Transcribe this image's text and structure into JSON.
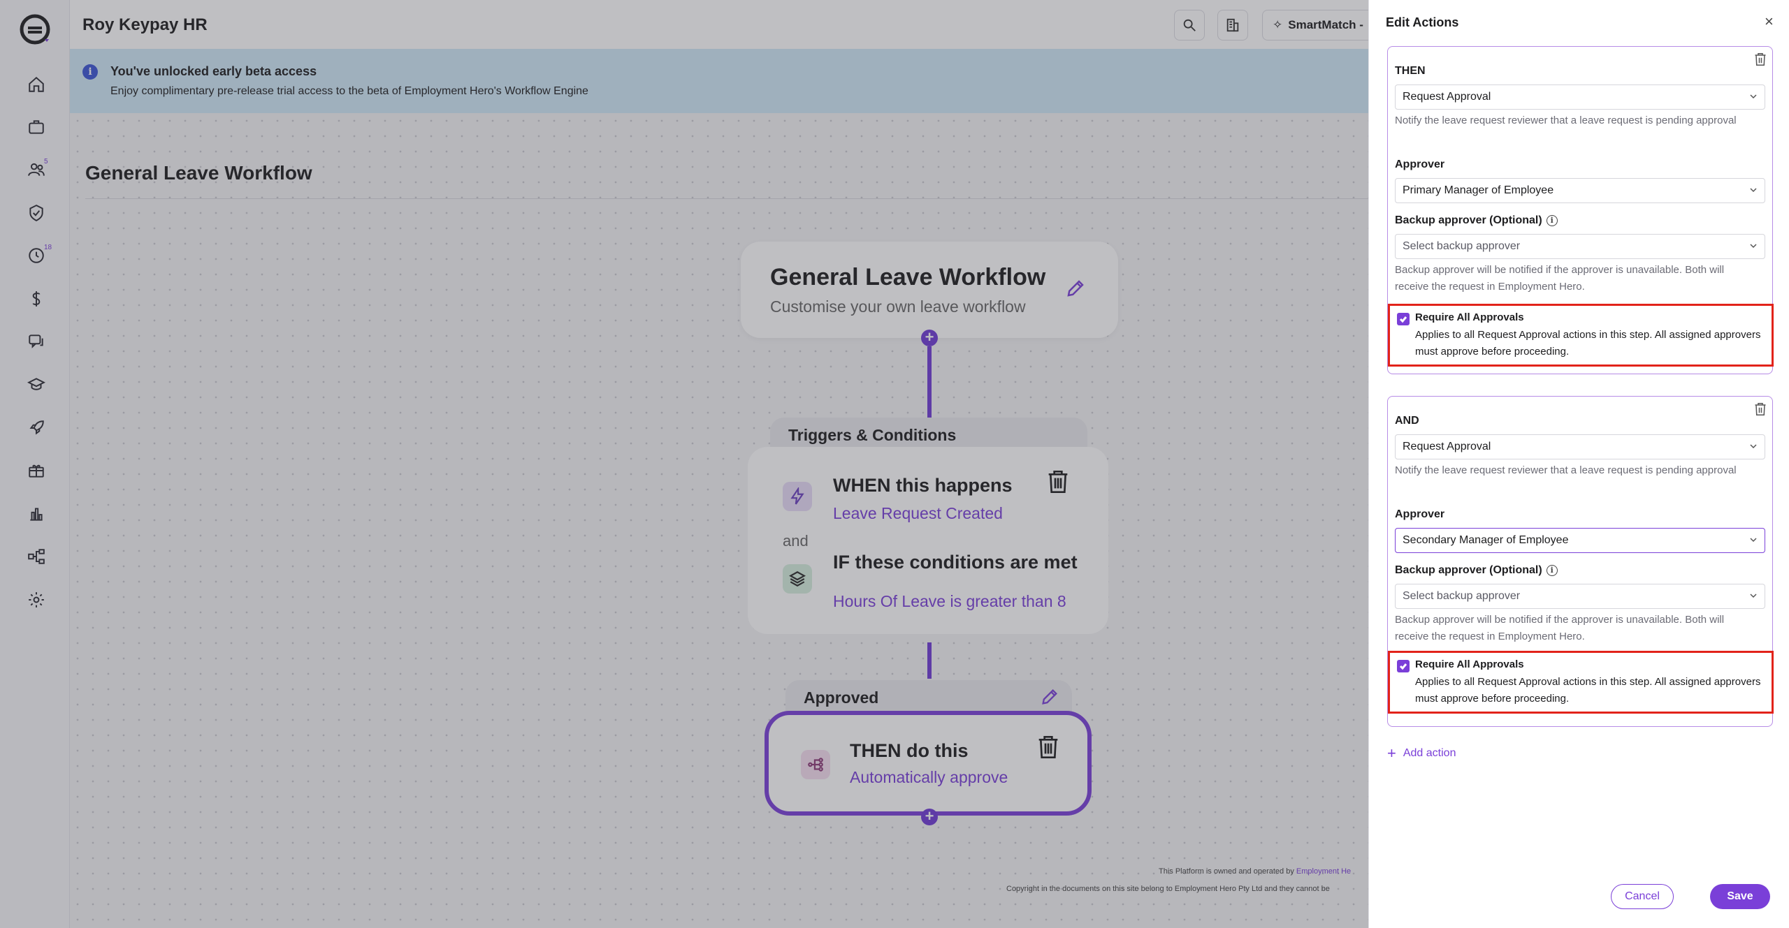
{
  "app": {
    "org_name": "Roy Keypay HR",
    "smartmatch_label": "SmartMatch -"
  },
  "nav": {
    "items": [
      "home-icon",
      "briefcase-icon",
      "people-icon",
      "shield-check-icon",
      "clock-icon",
      "dollar-icon",
      "chat-icon",
      "graduation-icon",
      "rocket-icon",
      "gift-icon",
      "chart-icon",
      "workflow-icon",
      "gear-icon"
    ],
    "people_badge": "5",
    "clock_badge": "18"
  },
  "banner": {
    "title": "You've unlocked early beta access",
    "text": "Enjoy complimentary pre-release trial access to the beta of Employment Hero's Workflow Engine"
  },
  "canvas": {
    "page_title": "General Leave Workflow",
    "workflow_card": {
      "title": "General Leave Workflow",
      "subtitle": "Customise your own leave workflow"
    },
    "triggers": {
      "tab_label": "Triggers & Conditions",
      "when_title": "WHEN this happens",
      "when_value": "Leave Request Created",
      "joiner": "and",
      "if_title": "IF these conditions are met",
      "if_value": "Hours Of Leave is greater than 8"
    },
    "approved": {
      "tab_label": "Approved",
      "then_title": "THEN do this",
      "then_value": "Automatically approve"
    },
    "footer": {
      "line1": "This Platform is owned and operated by",
      "line1_link": "Employment He",
      "line2": "Copyright in the documents on this site belong to Employment Hero Pty Ltd and they cannot be"
    }
  },
  "panel": {
    "title": "Edit Actions",
    "actions": [
      {
        "keyword": "THEN",
        "action_value": "Request Approval",
        "action_hint": "Notify the leave request reviewer that a leave request is pending approval",
        "approver_label": "Approver",
        "approver_value": "Primary Manager of Employee",
        "backup_label": "Backup approver (Optional)",
        "backup_placeholder": "Select backup approver",
        "backup_hint": "Backup approver will be notified if the approver is unavailable. Both will receive the request in Employment Hero.",
        "require_title": "Require All Approvals",
        "require_text": "Applies to all Request Approval actions in this step. All assigned approvers must approve before proceeding.",
        "require_checked": true
      },
      {
        "keyword": "AND",
        "action_value": "Request Approval",
        "action_hint": "Notify the leave request reviewer that a leave request is pending approval",
        "approver_label": "Approver",
        "approver_value": "Secondary Manager of Employee",
        "backup_label": "Backup approver (Optional)",
        "backup_placeholder": "Select backup approver",
        "backup_hint": "Backup approver will be notified if the approver is unavailable. Both will receive the request in Employment Hero.",
        "require_title": "Require All Approvals",
        "require_text": "Applies to all Request Approval actions in this step. All assigned approvers must approve before proceeding.",
        "require_checked": true
      }
    ],
    "add_action": "Add action",
    "cancel": "Cancel",
    "save": "Save"
  },
  "colors": {
    "accent": "#7a3fd8",
    "highlight": "#e2231a",
    "banner": "#cfe9f8"
  }
}
